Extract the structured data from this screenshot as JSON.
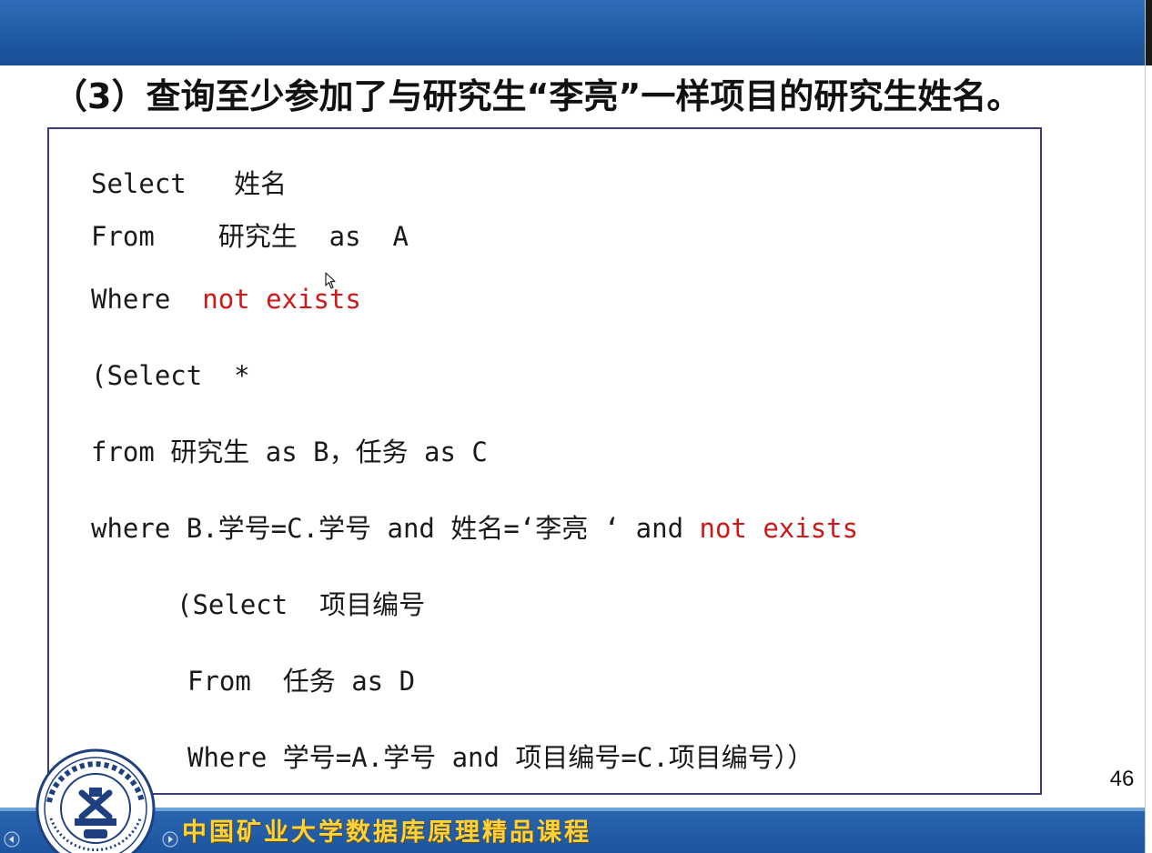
{
  "slide": {
    "title": "（3）查询至少参加了与研究生“李亮”一样项目的研究生姓名。",
    "page_number": "46",
    "footer_title": "中国矿业大学数据库原理精品课程"
  },
  "code": {
    "line1": {
      "kw": "Select",
      "rest": "姓名"
    },
    "line2": {
      "kw": "From",
      "table": "研究生",
      "as": "as",
      "alias": "A"
    },
    "line3": {
      "kw": "Where",
      "red": "not exists"
    },
    "line4": {
      "open": "(Select",
      "star": "*"
    },
    "line5": {
      "text": "from 研究生 as B，任务 as C"
    },
    "line6": {
      "text": "where B.学号=C.学号 and 姓名=‘李亮 ‘ and ",
      "red": "not exists"
    },
    "line7": {
      "text": "(Select  项目编号"
    },
    "line8": {
      "text": "From  任务 as D"
    },
    "line9": {
      "text": "Where 学号=A.学号 and 项目编号=C.项目编号））"
    }
  },
  "colors": {
    "header_blue": "#1f5aa4",
    "keyword_red": "#d01818",
    "footer_text_gold": "#ffd23a",
    "box_border": "#3d3d78"
  },
  "icons": {
    "logo": "university-seal-icon",
    "cursor": "mouse-pointer-icon",
    "player": [
      "previous-slide-icon",
      "next-slide-icon"
    ]
  }
}
